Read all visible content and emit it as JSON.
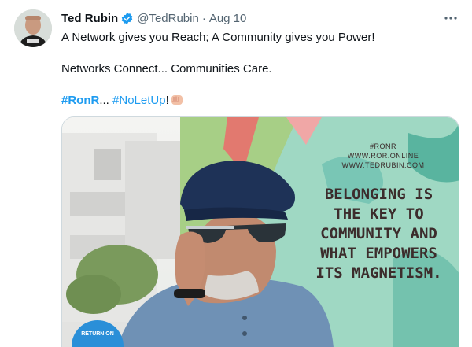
{
  "tweet": {
    "author_name": "Ted Rubin",
    "handle": "@TedRubin",
    "separator": "·",
    "date": "Aug 10",
    "more_label": "···",
    "line1": "A Network gives you Reach; A Community gives you Power!",
    "line2": "Networks Connect... Communities Care.",
    "hashtag1": "#RonR",
    "ellipsis": "...",
    "hashtag2": "#NoLetUp",
    "exclaim": "!"
  },
  "media": {
    "small_line1": "#RONR",
    "small_line2": "WWW.ROR.ONLINE",
    "small_line3": "WWW.TEDRUBIN.COM",
    "quote_lines": [
      "BELONGING IS",
      "THE KEY TO",
      "COMMUNITY AND",
      "WHAT EMPOWERS",
      "ITS MAGNETISM."
    ],
    "badge_text": "RETURN ON"
  },
  "colors": {
    "link": "#1d9bf0",
    "verified": "#1d9bf0",
    "text": "#0f1419",
    "secondary": "#536471"
  },
  "icons": [
    "verified-badge-icon",
    "more-icon",
    "fist-emoji-icon"
  ]
}
